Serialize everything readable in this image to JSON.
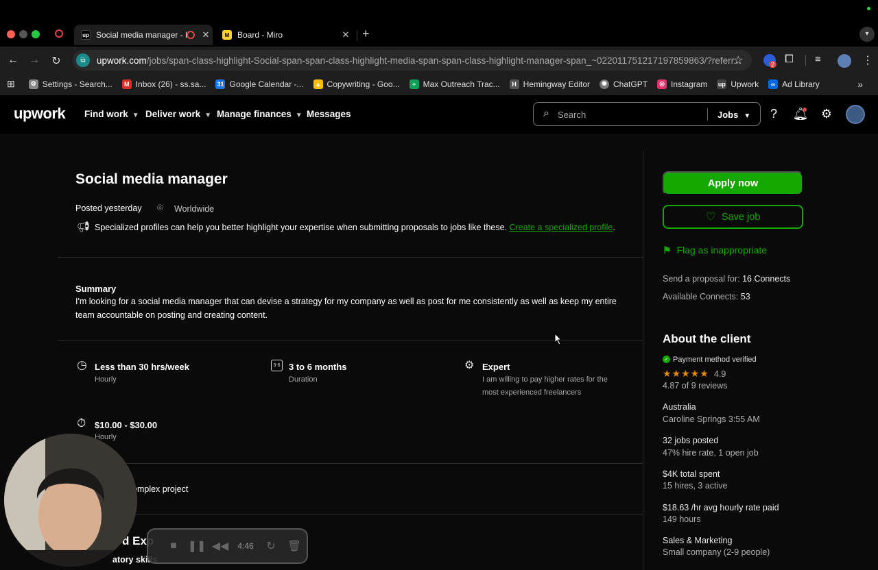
{
  "browser": {
    "tabs": [
      {
        "title": "Social media manager - Mi",
        "favicon": "up"
      },
      {
        "title": "Board - Miro",
        "favicon": "M"
      }
    ],
    "url_host": "upwork.com",
    "url_path": "/jobs/span-class-highlight-Social-span-span-class-highlight-media-span-span-class-highlight-manager-span_~022011751217197859863/?referr...",
    "extension_badge": "2",
    "bookmarks": [
      {
        "label": "Settings - Search...",
        "icon": "gear-icon",
        "color": "#888888"
      },
      {
        "label": "Inbox (26) - ss.sa...",
        "icon": "gmail-icon",
        "color": "#d93025"
      },
      {
        "label": "Google Calendar -...",
        "icon": "calendar-icon",
        "color": "#1a73e8"
      },
      {
        "label": "Copywriting - Goo...",
        "icon": "drive-icon",
        "color": "#fbbc04"
      },
      {
        "label": "Max Outreach Trac...",
        "icon": "sheets-icon",
        "color": "#0f9d58"
      },
      {
        "label": "Hemingway Editor",
        "icon": "hemingway-icon",
        "color": "#555555"
      },
      {
        "label": "ChatGPT",
        "icon": "chatgpt-icon",
        "color": "#777777"
      },
      {
        "label": "Instagram",
        "icon": "instagram-icon",
        "color": "#e1306c"
      },
      {
        "label": "Upwork",
        "icon": "upwork-icon",
        "color": "#444444"
      },
      {
        "label": "Ad Library",
        "icon": "meta-icon",
        "color": "#0668e1"
      }
    ]
  },
  "header": {
    "logo": "upwork",
    "nav": [
      "Find work",
      "Deliver work",
      "Manage finances",
      "Messages"
    ],
    "search_placeholder": "Search",
    "search_scope": "Jobs"
  },
  "job": {
    "title": "Social media manager",
    "posted": "Posted yesterday",
    "location": "Worldwide",
    "notice": "Specialized profiles can help you better highlight your expertise when submitting proposals to jobs like these.",
    "notice_link": "Create a specialized profile",
    "summary_label": "Summary",
    "summary_line1": "I'm looking for a social media manager that can devise a strategy for my company as well as post for me consistently as well as keep my entire",
    "summary_line2": "team accountable on posting and creating content.",
    "details": [
      {
        "title": "Less than 30 hrs/week",
        "sub": "Hourly",
        "icon": "clock-icon"
      },
      {
        "title": "3 to 6 months",
        "sub": "Duration",
        "icon": "calendar-icon"
      },
      {
        "title": "Expert",
        "sub": "I am willing to pay higher rates for the",
        "sub2": "most experienced freelancers",
        "icon": "expert-icon"
      },
      {
        "title": "$10.00 - $30.00",
        "sub": "Hourly",
        "icon": "stopwatch-icon"
      }
    ],
    "project_type_partial": "omplex project",
    "section_partial": "d Exp",
    "skills_partial": "atory skills"
  },
  "sidebar": {
    "apply_label": "Apply now",
    "save_label": "Save job",
    "flag_label": "Flag as inappropriate",
    "proposal_label": "Send a proposal for:",
    "proposal_value": "16 Connects",
    "available_label": "Available Connects:",
    "available_value": "53",
    "about_title": "About the client",
    "payment_verified": "Payment method verified",
    "rating": "4.9",
    "rating_stars": 5,
    "reviews": "4.87 of 9 reviews",
    "country": "Australia",
    "city_time": "Caroline Springs 3:55 AM",
    "jobs_posted": "32 jobs posted",
    "hire_rate": "47% hire rate, 1 open job",
    "total_spent": "$4K total spent",
    "hires": "15 hires, 3 active",
    "avg_rate": "$18.63 /hr avg hourly rate paid",
    "hours": "149 hours",
    "industry": "Sales & Marketing",
    "company_size": "Small company (2-9 people)"
  },
  "recorder": {
    "time": "4:46"
  },
  "colors": {
    "accent": "#14a800",
    "star": "#e88b00"
  }
}
